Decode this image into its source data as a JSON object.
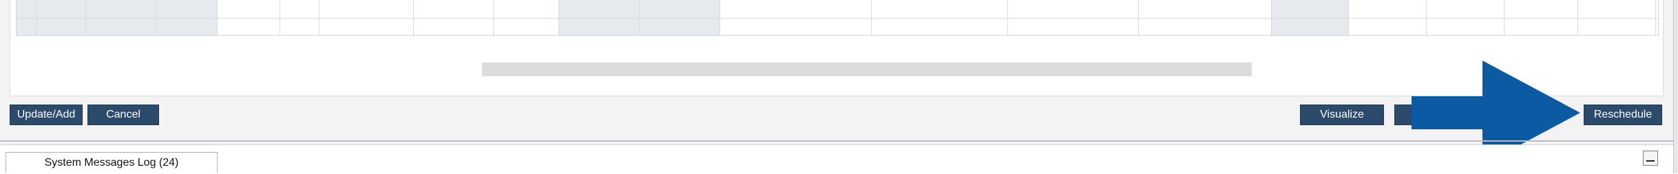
{
  "buttons": {
    "update_add": "Update/Add",
    "cancel": "Cancel",
    "visualize": "Visualize",
    "reschedule": "Reschedule"
  },
  "bottom_tab": {
    "label": "System Messages Log (24)"
  },
  "colors": {
    "button_bg": "#2c4a6b",
    "arrow": "#0b5aa3",
    "grid_shade": "#e6eaee"
  },
  "icons": {
    "annotation": "arrow-right-icon",
    "minimize": "minimize-icon"
  }
}
